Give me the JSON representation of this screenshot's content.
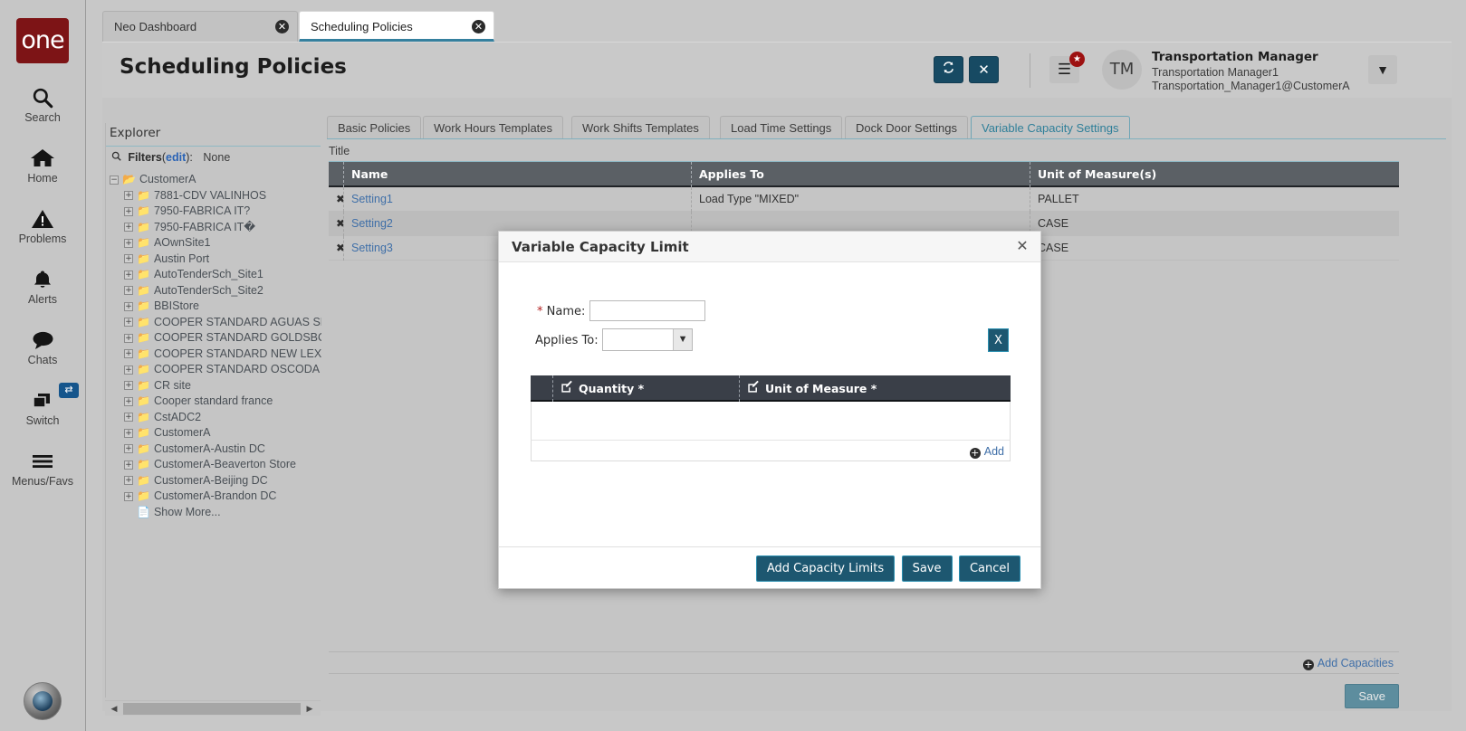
{
  "rail": {
    "logo_text": "one",
    "items": [
      {
        "label": "Search",
        "icon": "search-icon"
      },
      {
        "label": "Home",
        "icon": "home-icon"
      },
      {
        "label": "Problems",
        "icon": "warning-icon"
      },
      {
        "label": "Alerts",
        "icon": "bell-icon"
      },
      {
        "label": "Chats",
        "icon": "chat-icon"
      },
      {
        "label": "Switch",
        "icon": "switch-icon",
        "badge": "⇄"
      },
      {
        "label": "Menus/Favs",
        "icon": "hamburger-icon"
      }
    ]
  },
  "browser_tabs": [
    {
      "label": "Neo Dashboard",
      "active": false,
      "close": "✕"
    },
    {
      "label": "Scheduling Policies",
      "active": true,
      "close": "✕"
    }
  ],
  "header": {
    "title": "Scheduling Policies",
    "refresh_label": "↻",
    "close_label": "✕",
    "menu_label": "☰",
    "menu_badge": "★",
    "avatar_initials": "TM",
    "user_name": "Transportation Manager",
    "user_login": "Transportation Manager1",
    "user_email": "Transportation_Manager1@CustomerA",
    "caret": "▼"
  },
  "explorer": {
    "title": "Explorer",
    "search_icon": "search-icon",
    "filters_label": "Filters",
    "filters_edit": "edit",
    "filters_paren_open": "(",
    "filters_paren_close": "):",
    "filters_value": "None",
    "tree": [
      {
        "label": "CustomerA",
        "level": "root",
        "expander": "−",
        "icon": "open-folder-icon"
      },
      {
        "label": "7881-CDV VALINHOS",
        "level": "child",
        "expander": "+",
        "icon": "folder-icon"
      },
      {
        "label": "7950-FABRICA IT?",
        "level": "child",
        "expander": "+",
        "icon": "folder-icon"
      },
      {
        "label": "7950-FABRICA IT�",
        "level": "child",
        "expander": "+",
        "icon": "folder-icon"
      },
      {
        "label": "AOwnSite1",
        "level": "child",
        "expander": "+",
        "icon": "folder-icon"
      },
      {
        "label": "Austin Port",
        "level": "child",
        "expander": "+",
        "icon": "folder-icon"
      },
      {
        "label": "AutoTenderSch_Site1",
        "level": "child",
        "expander": "+",
        "icon": "folder-icon"
      },
      {
        "label": "AutoTenderSch_Site2",
        "level": "child",
        "expander": "+",
        "icon": "folder-icon"
      },
      {
        "label": "BBIStore",
        "level": "child",
        "expander": "+",
        "icon": "folder-icon"
      },
      {
        "label": "COOPER STANDARD AGUAS SEALING (S",
        "level": "child",
        "expander": "+",
        "icon": "folder-icon"
      },
      {
        "label": "COOPER STANDARD GOLDSBORO",
        "level": "child",
        "expander": "+",
        "icon": "folder-icon"
      },
      {
        "label": "COOPER STANDARD NEW LEXINGTON",
        "level": "child",
        "expander": "+",
        "icon": "folder-icon"
      },
      {
        "label": "COOPER STANDARD OSCODA",
        "level": "child",
        "expander": "+",
        "icon": "folder-icon"
      },
      {
        "label": "CR site",
        "level": "child",
        "expander": "+",
        "icon": "folder-icon"
      },
      {
        "label": "Cooper standard france",
        "level": "child",
        "expander": "+",
        "icon": "folder-icon"
      },
      {
        "label": "CstADC2",
        "level": "child",
        "expander": "+",
        "icon": "folder-icon"
      },
      {
        "label": "CustomerA",
        "level": "child",
        "expander": "+",
        "icon": "folder-icon"
      },
      {
        "label": "CustomerA-Austin DC",
        "level": "child",
        "expander": "+",
        "icon": "folder-icon"
      },
      {
        "label": "CustomerA-Beaverton Store",
        "level": "child",
        "expander": "+",
        "icon": "folder-icon"
      },
      {
        "label": "CustomerA-Beijing DC",
        "level": "child",
        "expander": "+",
        "icon": "folder-icon"
      },
      {
        "label": "CustomerA-Brandon DC",
        "level": "child",
        "expander": "+",
        "icon": "folder-icon"
      },
      {
        "label": "Show More...",
        "level": "leaf",
        "expander": "",
        "icon": "document-icon"
      }
    ],
    "scroll_left": "◀",
    "scroll_right": "▶"
  },
  "main": {
    "tabs": [
      {
        "label": "Basic Policies",
        "active": false
      },
      {
        "label": "Work Hours Templates",
        "active": false
      },
      {
        "label": "Work Shifts Templates",
        "active": false
      },
      {
        "label": "Load Time Settings",
        "active": false
      },
      {
        "label": "Dock Door Settings",
        "active": false
      },
      {
        "label": "Variable Capacity Settings",
        "active": true
      }
    ],
    "grid_title": "Title",
    "columns": [
      "Name",
      "Applies To",
      "Unit of Measure(s)"
    ],
    "rows": [
      {
        "delete": "✖",
        "name": "Setting1",
        "applies_to": "Load Type \"MIXED\"",
        "uom": "PALLET"
      },
      {
        "delete": "✖",
        "name": "Setting2",
        "applies_to": "",
        "uom": "CASE"
      },
      {
        "delete": "✖",
        "name": "Setting3",
        "applies_to": "",
        "uom": "CASE"
      }
    ],
    "add_capacities_label": "Add Capacities",
    "save_label": "Save"
  },
  "modal": {
    "title": "Variable Capacity Limit",
    "close": "✕",
    "name_label": "Name:",
    "name_required": "*",
    "name_value": "",
    "applies_to_label": "Applies To:",
    "applies_to_value": "",
    "applies_to_options": [
      ""
    ],
    "x_button_label": "X",
    "sub_columns": [
      "Quantity *",
      "Unit of Measure *"
    ],
    "sub_rows": [],
    "add_label": "Add",
    "buttons": [
      {
        "label": "Add Capacity Limits"
      },
      {
        "label": "Save"
      },
      {
        "label": "Cancel"
      }
    ]
  },
  "colors": {
    "brand_red": "#7d1416",
    "accent_teal": "#2f7f99",
    "button_dark_blue": "#1d5770",
    "grid_header": "#5b6065",
    "sub_grid_header": "#3a3f48",
    "link_blue": "#3f6fa8",
    "page_bg": "#c5c5c5"
  }
}
